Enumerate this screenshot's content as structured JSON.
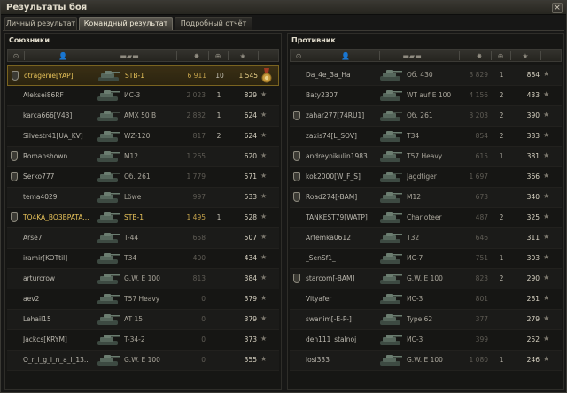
{
  "window": {
    "title": "Результаты боя",
    "close_label": "×"
  },
  "tabs": [
    {
      "label": "Личный результат",
      "active": false
    },
    {
      "label": "Командный результат",
      "active": true
    },
    {
      "label": "Подробный отчёт",
      "active": false
    }
  ],
  "left_panel": {
    "title": "Союзники",
    "rows": [
      {
        "player": "otragenie[YAP]",
        "vehicle": "STB-1",
        "damage": "6 911",
        "kills": "10",
        "xp": "1 545",
        "badge": true,
        "self": true,
        "medal": true
      },
      {
        "player": "Aleksei86RF",
        "vehicle": "ИС-3",
        "damage": "2 023",
        "kills": "1",
        "xp": "829",
        "badge": false
      },
      {
        "player": "karca666[V43]",
        "vehicle": "AMX 50 B",
        "damage": "2 882",
        "kills": "1",
        "xp": "624",
        "badge": false
      },
      {
        "player": "Silvestr41[UA_KV]",
        "vehicle": "WZ-120",
        "damage": "817",
        "kills": "2",
        "xp": "624",
        "badge": false
      },
      {
        "player": "Romanshown",
        "vehicle": "M12",
        "damage": "1 265",
        "kills": "",
        "xp": "620",
        "badge": true
      },
      {
        "player": "Serko777",
        "vehicle": "Об. 261",
        "damage": "1 779",
        "kills": "",
        "xp": "571",
        "badge": true
      },
      {
        "player": "tema4029",
        "vehicle": "Löwe",
        "damage": "997",
        "kills": "",
        "xp": "533",
        "badge": false
      },
      {
        "player": "TO4KA_BO3BPATA...",
        "vehicle": "STB-1",
        "damage": "1 495",
        "kills": "1",
        "xp": "528",
        "badge": true,
        "gold": true
      },
      {
        "player": "Arse7",
        "vehicle": "T-44",
        "damage": "658",
        "kills": "",
        "xp": "507",
        "badge": false
      },
      {
        "player": "iramir[KOTtil]",
        "vehicle": "T34",
        "damage": "400",
        "kills": "",
        "xp": "434",
        "badge": false
      },
      {
        "player": "arturcrow",
        "vehicle": "G.W. E 100",
        "damage": "813",
        "kills": "",
        "xp": "384",
        "badge": false
      },
      {
        "player": "aev2",
        "vehicle": "T57 Heavy",
        "damage": "0",
        "kills": "",
        "xp": "379",
        "badge": false
      },
      {
        "player": "Lehail15",
        "vehicle": "AT 15",
        "damage": "0",
        "kills": "",
        "xp": "379",
        "badge": false
      },
      {
        "player": "Jackcs[KRYM]",
        "vehicle": "T-34-2",
        "damage": "0",
        "kills": "",
        "xp": "373",
        "badge": false
      },
      {
        "player": "O_r_i_g_i_n_a_l_13..",
        "vehicle": "G.W. E 100",
        "damage": "0",
        "kills": "",
        "xp": "355",
        "badge": false
      }
    ]
  },
  "right_panel": {
    "title": "Противник",
    "rows": [
      {
        "player": "Da_4e_3a_Ha",
        "vehicle": "Об. 430",
        "damage": "3 829",
        "kills": "1",
        "xp": "884",
        "badge": false
      },
      {
        "player": "Baty2307",
        "vehicle": "WT auf E 100",
        "damage": "4 156",
        "kills": "2",
        "xp": "433",
        "badge": false
      },
      {
        "player": "zahar277[74RU1]",
        "vehicle": "Об. 261",
        "damage": "3 203",
        "kills": "2",
        "xp": "390",
        "badge": true
      },
      {
        "player": "zaxis74[L_SOV]",
        "vehicle": "T34",
        "damage": "854",
        "kills": "2",
        "xp": "383",
        "badge": false
      },
      {
        "player": "andreynikulin1983...",
        "vehicle": "T57 Heavy",
        "damage": "615",
        "kills": "1",
        "xp": "381",
        "badge": true
      },
      {
        "player": "kok2000[W_F_S]",
        "vehicle": "Jagdtiger",
        "damage": "1 697",
        "kills": "",
        "xp": "366",
        "badge": true
      },
      {
        "player": "Road274[-BAM]",
        "vehicle": "M12",
        "damage": "673",
        "kills": "",
        "xp": "340",
        "badge": true
      },
      {
        "player": "TANKEST79[WATP]",
        "vehicle": "Charioteer",
        "damage": "487",
        "kills": "2",
        "xp": "325",
        "badge": false
      },
      {
        "player": "Artemka0612",
        "vehicle": "T32",
        "damage": "646",
        "kills": "",
        "xp": "311",
        "badge": false
      },
      {
        "player": "_SenSf1_",
        "vehicle": "ИС-7",
        "damage": "751",
        "kills": "1",
        "xp": "303",
        "badge": false
      },
      {
        "player": "starcom[-BAM]",
        "vehicle": "G.W. E 100",
        "damage": "823",
        "kills": "2",
        "xp": "290",
        "badge": true
      },
      {
        "player": "Vityafer",
        "vehicle": "ИС-3",
        "damage": "801",
        "kills": "",
        "xp": "281",
        "badge": false
      },
      {
        "player": "swanim[-E-P-]",
        "vehicle": "Type 62",
        "damage": "377",
        "kills": "",
        "xp": "279",
        "badge": false
      },
      {
        "player": "den111_stalnoj",
        "vehicle": "ИС-3",
        "damage": "399",
        "kills": "",
        "xp": "252",
        "badge": false
      },
      {
        "player": "losi333",
        "vehicle": "G.W. E 100",
        "damage": "1 080",
        "kills": "1",
        "xp": "246",
        "badge": false
      }
    ]
  },
  "icons": {
    "badge": "mastery-badge-icon",
    "player_col": "player-icon",
    "vehicle_col": "tank-icon",
    "damage_col": "damage-icon",
    "kills_col": "kills-icon",
    "xp_col": "star-icon",
    "medal": "medal-icon"
  },
  "colors": {
    "gold": "#e8c35a",
    "self_row": "#3a2f14",
    "background": "#171716"
  }
}
